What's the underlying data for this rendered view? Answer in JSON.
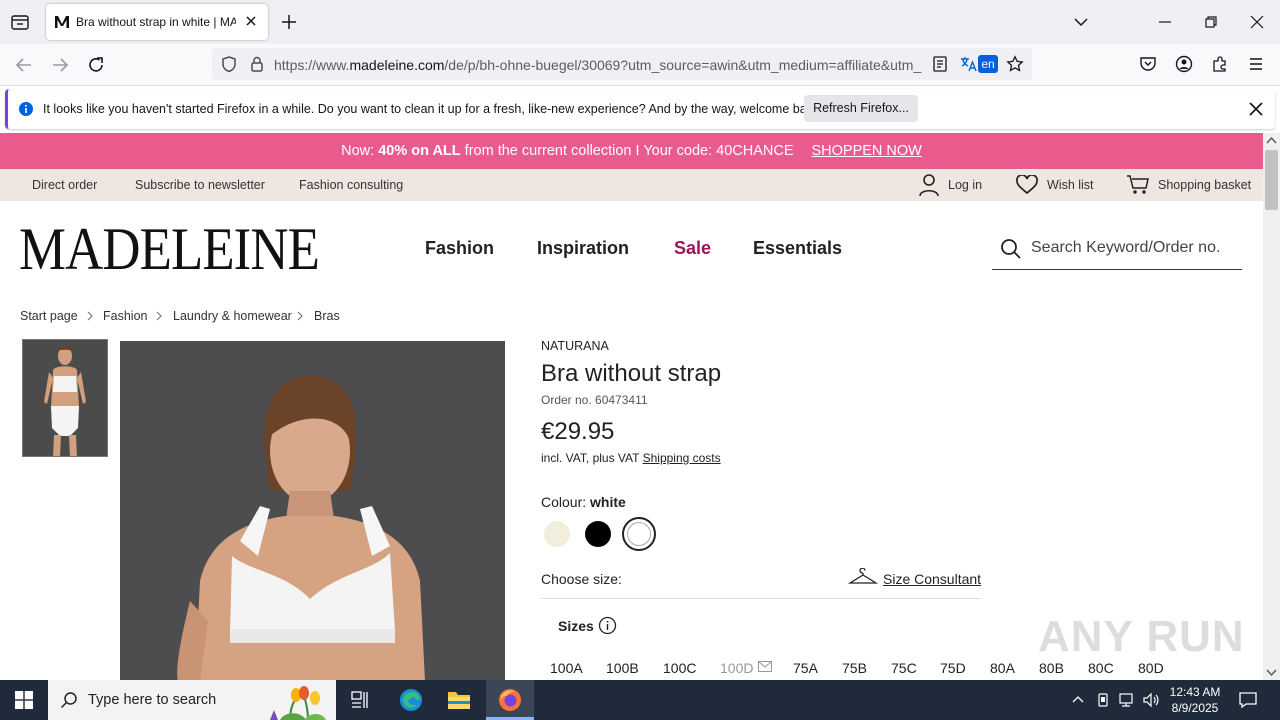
{
  "browser": {
    "tab_title": "Bra without strap in white | MADELEINE",
    "url_prefix": "https://www.",
    "url_domain": "madeleine.com",
    "url_rest": "/de/p/bh-ohne-buegel/30069?utm_source=awin&utm_medium=affiliate&utm_",
    "translate_badge": "en"
  },
  "notification": {
    "text": "It looks like you haven't started Firefox in a while. Do you want to clean it up for a fresh, like-new experience? And by the way, welcome back!",
    "button": "Refresh Firefox..."
  },
  "promo": {
    "prefix": "Now: ",
    "bold": "40% on ALL",
    "middle": " from the current collection I Your code: 40CHANCE",
    "link": "SHOPPEN NOW"
  },
  "service": {
    "direct_order": "Direct order",
    "newsletter": "Subscribe to newsletter",
    "consulting": "Fashion consulting",
    "login": "Log in",
    "wishlist": "Wish list",
    "basket": "Shopping basket"
  },
  "header": {
    "logo": "MADELEINE",
    "nav": [
      "Fashion",
      "Inspiration",
      "Sale",
      "Essentials"
    ],
    "sale_color": "#a0125a",
    "search_placeholder": "Search Keyword/Order no."
  },
  "breadcrumb": [
    "Start page",
    "Fashion",
    "Laundry & homewear",
    "Bras"
  ],
  "product": {
    "brand": "NATURANA",
    "title": "Bra without strap",
    "order_no": "Order no. 60473411",
    "price": "€29.95",
    "vat_text": "incl. VAT, plus VAT ",
    "shipping_link": "Shipping costs",
    "colour_label": "Colour: ",
    "colour_value": "white",
    "swatches": [
      "#f1eedc",
      "#000000",
      "#ffffff"
    ],
    "choose_size": "Choose size:",
    "size_consultant": "Size Consultant",
    "sizes_label": "Sizes",
    "sizes": [
      "100A",
      "100B",
      "100C",
      "100D",
      "75A",
      "75B",
      "75C",
      "75D",
      "80A",
      "80B",
      "80C",
      "80D"
    ]
  },
  "watermark": "ANY RUN",
  "taskbar": {
    "search_placeholder": "Type here to search",
    "time": "12:43 AM",
    "date": "8/9/2025"
  }
}
